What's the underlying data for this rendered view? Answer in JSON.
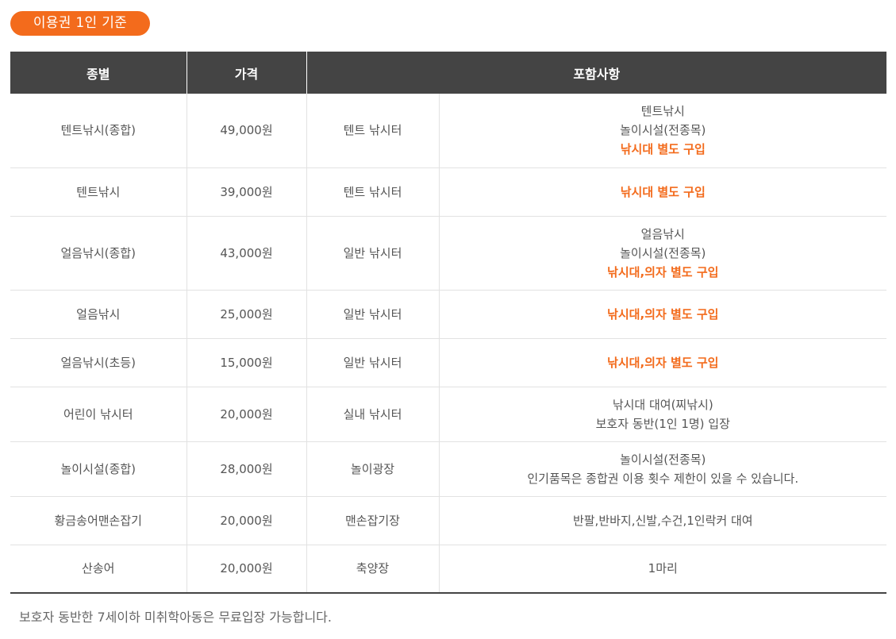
{
  "badge": "이용권 1인 기준",
  "colors": {
    "accent": "#f36b1c",
    "header_bg": "#444444",
    "text": "#555555"
  },
  "table": {
    "headers": [
      "종별",
      "가격",
      "포함사항"
    ],
    "rows": [
      {
        "type": "텐트낚시(종합)",
        "price": "49,000원",
        "place": "텐트 낚시터",
        "includes": [
          {
            "text": "텐트낚시",
            "highlight": false
          },
          {
            "text": "놀이시설(전종목)",
            "highlight": false
          },
          {
            "text": "낚시대 별도 구입",
            "highlight": true
          }
        ]
      },
      {
        "type": "텐트낚시",
        "price": "39,000원",
        "place": "텐트 낚시터",
        "includes": [
          {
            "text": "낚시대 별도 구입",
            "highlight": true
          }
        ]
      },
      {
        "type": "얼음낚시(종합)",
        "price": "43,000원",
        "place": "일반 낚시터",
        "includes": [
          {
            "text": "얼음낚시",
            "highlight": false
          },
          {
            "text": "놀이시설(전종목)",
            "highlight": false
          },
          {
            "text": "낚시대,의자 별도 구입",
            "highlight": true
          }
        ]
      },
      {
        "type": "얼음낚시",
        "price": "25,000원",
        "place": "일반 낚시터",
        "includes": [
          {
            "text": "낚시대,의자 별도 구입",
            "highlight": true
          }
        ]
      },
      {
        "type": "얼음낚시(초등)",
        "price": "15,000원",
        "place": "일반 낚시터",
        "includes": [
          {
            "text": "낚시대,의자 별도 구입",
            "highlight": true
          }
        ]
      },
      {
        "type": "어린이 낚시터",
        "price": "20,000원",
        "place": "실내 낚시터",
        "includes": [
          {
            "text": "낚시대 대여(찌낚시)",
            "highlight": false
          },
          {
            "text": "보호자 동반(1인 1명) 입장",
            "highlight": false
          }
        ]
      },
      {
        "type": "놀이시설(종합)",
        "price": "28,000원",
        "place": "놀이광장",
        "includes": [
          {
            "text": "놀이시설(전종목)",
            "highlight": false
          },
          {
            "text": "인기품목은 종합권 이용 횟수 제한이 있을 수 있습니다.",
            "highlight": false
          }
        ]
      },
      {
        "type": "황금송어맨손잡기",
        "price": "20,000원",
        "place": "맨손잡기장",
        "includes": [
          {
            "text": "반팔,반바지,신발,수건,1인락커 대여",
            "highlight": false
          }
        ]
      },
      {
        "type": "산송어",
        "price": "20,000원",
        "place": "축양장",
        "includes": [
          {
            "text": "1마리",
            "highlight": false
          }
        ]
      }
    ]
  },
  "note": "보호자 동반한 7세이하 미취학아동은 무료입장 가능합니다."
}
